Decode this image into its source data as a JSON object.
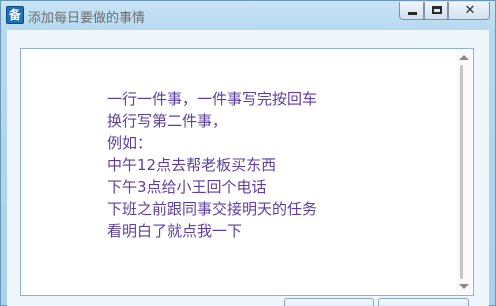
{
  "window": {
    "title": "添加每日要做的事情",
    "app_icon_char": "备"
  },
  "editor": {
    "text": "一行一件事，一件事写完按回车\n换行写第二件事，\n例如：\n中午12点去帮老板买东西\n下午3点给小王回个电话\n下班之前跟同事交接明天的任务\n看明白了就点我一下"
  },
  "colors": {
    "text": "#5b3fa2",
    "title": "#6c6c6c",
    "frame": "#aed6ee"
  },
  "icons": {
    "app": "app-icon",
    "minimize": "minimize-icon",
    "maximize": "maximize-icon",
    "close": "close-icon"
  }
}
